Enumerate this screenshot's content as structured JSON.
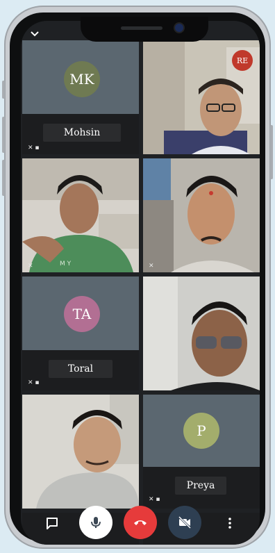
{
  "participants": [
    {
      "id": "mohsin",
      "initials": "MK",
      "name": "Mohsin",
      "avatar_color": "#6f7a52"
    },
    {
      "id": "top-right",
      "initials": "RE",
      "avatar_color": "#c0392b"
    },
    {
      "id": "toral",
      "initials": "TA",
      "name": "Toral",
      "avatar_color": "#b26f93"
    },
    {
      "id": "preya",
      "initials": "P",
      "name": "Preya",
      "avatar_color": "#a3ad6c"
    }
  ],
  "toolbar": {
    "chat": "chat-icon",
    "mic": "mic-icon",
    "hangup": "hangup-icon",
    "camera": "camera-off-icon",
    "more": "more-icon"
  },
  "colors": {
    "hangup": "#e63b3b",
    "mic_bg": "#ffffff",
    "camera_bg": "#2e3f52",
    "tile_placeholder": "#5b6770"
  }
}
